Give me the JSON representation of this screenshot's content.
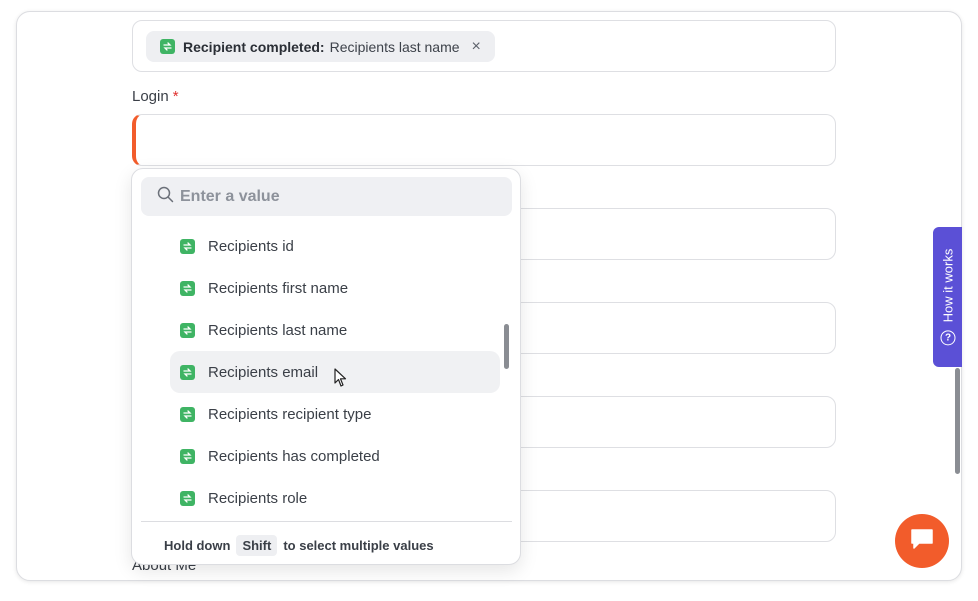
{
  "filter_chip": {
    "label": "Recipient completed:",
    "value": "Recipients last name",
    "close": "×",
    "icon": "tag-icon"
  },
  "login": {
    "label": "Login",
    "required_mark": "*"
  },
  "next_label_partial": "About Me",
  "dropdown": {
    "search_placeholder": "Enter a value",
    "items": [
      {
        "label": "Recipients id"
      },
      {
        "label": "Recipients first name"
      },
      {
        "label": "Recipients last name"
      },
      {
        "label": "Recipients email"
      },
      {
        "label": "Recipients recipient type"
      },
      {
        "label": "Recipients has completed"
      },
      {
        "label": "Recipients role"
      }
    ],
    "hovered_index": 3,
    "hint_prefix": "Hold down",
    "hint_key": "Shift",
    "hint_suffix": "to select multiple values"
  },
  "how_it_works": {
    "label": "How it works",
    "icon_glyph": "?"
  },
  "colors": {
    "tag_icon": "#3fb464",
    "error_accent": "#f25c2b",
    "how_tab": "#5b50d6",
    "chat_button": "#f25c2b"
  }
}
